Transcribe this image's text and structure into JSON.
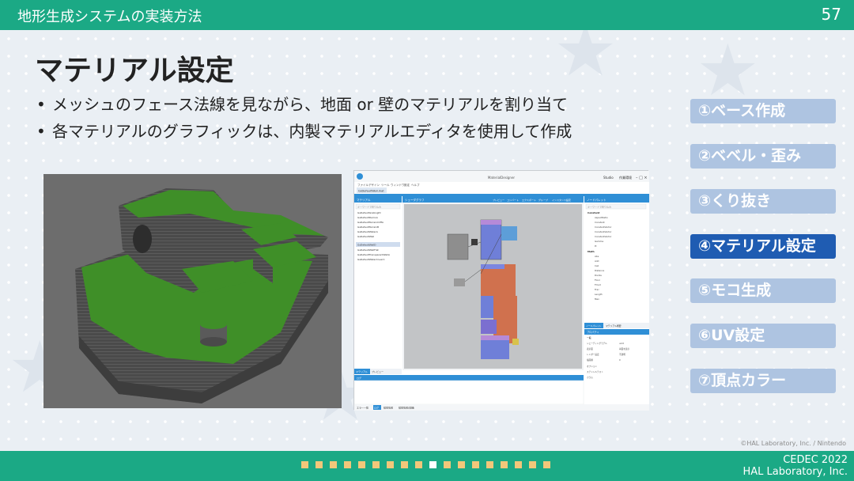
{
  "header": {
    "deck_title": "地形生成システムの実装方法",
    "page_number": "57"
  },
  "slide": {
    "title": "マテリアル設定",
    "bullets": [
      "メッシュのフェース法線を見ながら、地面 or 壁のマテリアルを割り当て",
      "各マテリアルのグラフィックは、内製マテリアルエディタを使用して作成"
    ]
  },
  "steps": [
    {
      "label": "①ベース作成",
      "active": false
    },
    {
      "label": "②ベベル・歪み",
      "active": false
    },
    {
      "label": "③くり抜き",
      "active": false
    },
    {
      "label": "④マテリアル設定",
      "active": true
    },
    {
      "label": "⑤モコ生成",
      "active": false
    },
    {
      "label": "⑥UV設定",
      "active": false
    },
    {
      "label": "⑦頂点カラー",
      "active": false
    }
  ],
  "editor": {
    "window_title": "MaterialDesigner",
    "menu": [
      "ファイル",
      "デザイン",
      "ツール",
      "ウィンドウ",
      "設定",
      "ヘルプ"
    ],
    "file_tab": "GsDefaultWall.mat",
    "left_panel_title": "マテリアル",
    "left_filter_placeholder": "キーワードで絞り込み",
    "materials": [
      "GsDefaultGrabLight",
      "GsDefaultDemoA",
      "GsDefaultTerrainCliffA",
      "GsDefaultTerrainB",
      "GsDefaultWaterA",
      "GsDefaultWall",
      "GsDefaultWallD",
      "GsDefaultWallFlat",
      "GsDefaultTransparentWallA",
      "GsDefaultWaterCoverC"
    ],
    "selected_material": 5,
    "left_tabs": [
      "マテリアル",
      "プレビュー"
    ],
    "graph_title": "シェーダグラフ",
    "graph_toolbar": [
      "プレビュー",
      "コンバート",
      "エクスポート",
      "グループ",
      "インスタンス設定"
    ],
    "right_panel_title": "ノードパレット",
    "node_search_placeholder": "キーワードで絞り込み",
    "node_groups": [
      {
        "name": "Constant",
        "items": [
          "AspectRatio",
          "Constant",
          "ConstantVector",
          "ConstantVector",
          "ConstantVector",
          "Gamma",
          "Pi"
        ]
      },
      {
        "name": "Math",
        "items": [
          "Abs",
          "Add",
          "Ceil",
          "Distance",
          "Divide",
          "Floor",
          "Fmod",
          "Frac",
          "Length",
          "Max"
        ]
      }
    ],
    "right_tabs": [
      "ノードパレット",
      "マテリアル概要"
    ],
    "property_title": "プロパティ",
    "property_group": "一般",
    "properties": [
      {
        "key": "シェーディングモデル",
        "value": "unlit"
      },
      {
        "key": "表示面",
        "value": "両面を表示"
      },
      {
        "key": "レンダー設定",
        "value": "不透明"
      },
      {
        "key": "描画順",
        "value": "0"
      }
    ],
    "property_sections": [
      "オプション",
      "ステンシルテスト",
      "カラム"
    ],
    "bottom_panel_title": "ログ",
    "status_tabs": [
      "エラー一覧",
      "ログ",
      "検索情報",
      "検索情報(詳細)"
    ],
    "status_active": 1,
    "title_controls": [
      "Studio",
      "作業環境"
    ]
  },
  "footer": {
    "copyright": "©HAL Laboratory, Inc. / Nintendo",
    "event": "CEDEC 2022",
    "company": "HAL Laboratory, Inc.",
    "progress_total": 18,
    "progress_current": 9
  },
  "colors": {
    "brand_green": "#1ba985",
    "step_inactive": "#aec4e1",
    "step_active": "#1f5cb2",
    "editor_accent": "#2f8fd6",
    "ground_green": "#3f8f28"
  }
}
